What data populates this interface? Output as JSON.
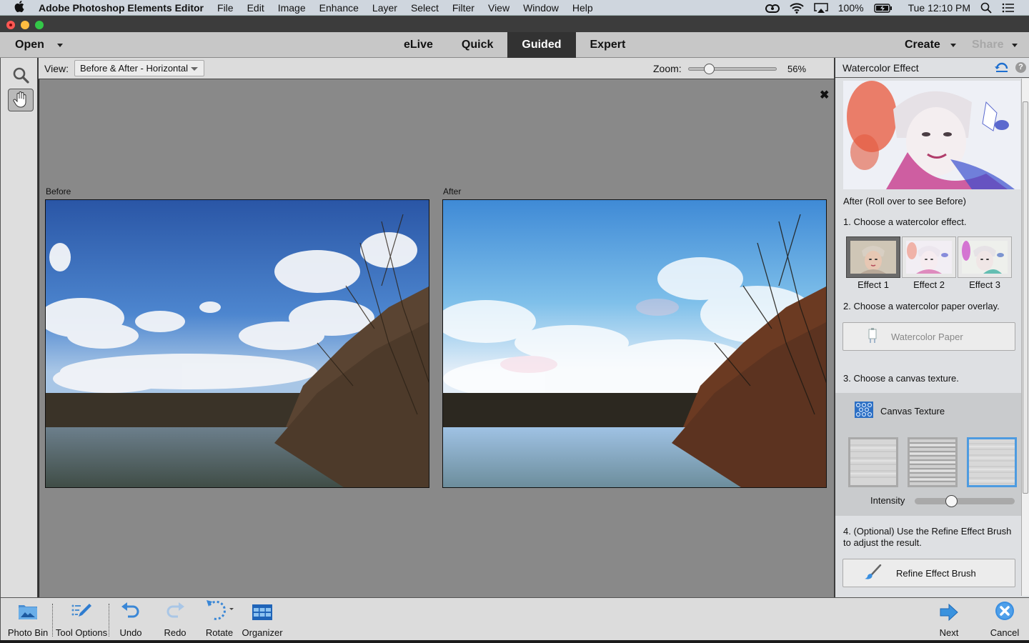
{
  "menubar": {
    "app_name": "Adobe Photoshop Elements Editor",
    "items": [
      "File",
      "Edit",
      "Image",
      "Enhance",
      "Layer",
      "Select",
      "Filter",
      "View",
      "Window",
      "Help"
    ],
    "battery": "100%",
    "clock": "Tue 12:10 PM"
  },
  "modebar": {
    "open_label": "Open",
    "tabs": [
      {
        "label": "eLive",
        "active": false
      },
      {
        "label": "Quick",
        "active": false
      },
      {
        "label": "Guided",
        "active": true
      },
      {
        "label": "Expert",
        "active": false
      }
    ],
    "create_label": "Create",
    "share_label": "Share"
  },
  "options": {
    "view_label": "View:",
    "view_value": "Before & After - Horizontal",
    "zoom_label": "Zoom:",
    "zoom_value": "56%",
    "zoom_fraction": 0.2
  },
  "canvas": {
    "before_label": "Before",
    "after_label": "After",
    "close_glyph": "✖"
  },
  "panel": {
    "title": "Watercolor Effect",
    "help_glyph": "?",
    "preview_caption": "After (Roll over to see Before)",
    "step1": "1. Choose a watercolor effect.",
    "effects": [
      {
        "label": "Effect 1",
        "selected": true
      },
      {
        "label": "Effect 2",
        "selected": false
      },
      {
        "label": "Effect 3",
        "selected": false
      }
    ],
    "step2": "2. Choose a watercolor paper overlay.",
    "paper_button": "Watercolor Paper",
    "step3": "3. Choose a canvas texture.",
    "texture_header": "Canvas Texture",
    "textures": [
      {
        "name": "texture-1",
        "selected": false
      },
      {
        "name": "texture-2",
        "selected": false
      },
      {
        "name": "texture-3",
        "selected": true
      }
    ],
    "intensity_label": "Intensity",
    "intensity_fraction": 0.35,
    "step4_line1": "4. (Optional) Use the Refine Effect Brush",
    "step4_line2": "to adjust the result.",
    "refine_button": "Refine Effect Brush"
  },
  "bottombar": {
    "photo_bin": "Photo Bin",
    "tool_options": "Tool Options",
    "undo": "Undo",
    "redo": "Redo",
    "rotate": "Rotate",
    "organizer": "Organizer",
    "next": "Next",
    "cancel": "Cancel"
  },
  "colors": {
    "accent_blue": "#4d9be0",
    "active_tab": "#323232"
  }
}
